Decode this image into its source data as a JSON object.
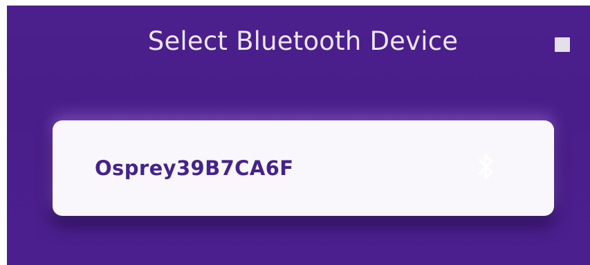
{
  "dialog": {
    "title": "Select Bluetooth Device"
  },
  "devices": [
    {
      "name": "Osprey39B7CA6F",
      "icon": "bluetooth-icon"
    }
  ],
  "colors": {
    "background": "#4b1f8c",
    "card": "#f9f7fc",
    "device_text": "#45238a",
    "title_text": "#ece6f7"
  }
}
